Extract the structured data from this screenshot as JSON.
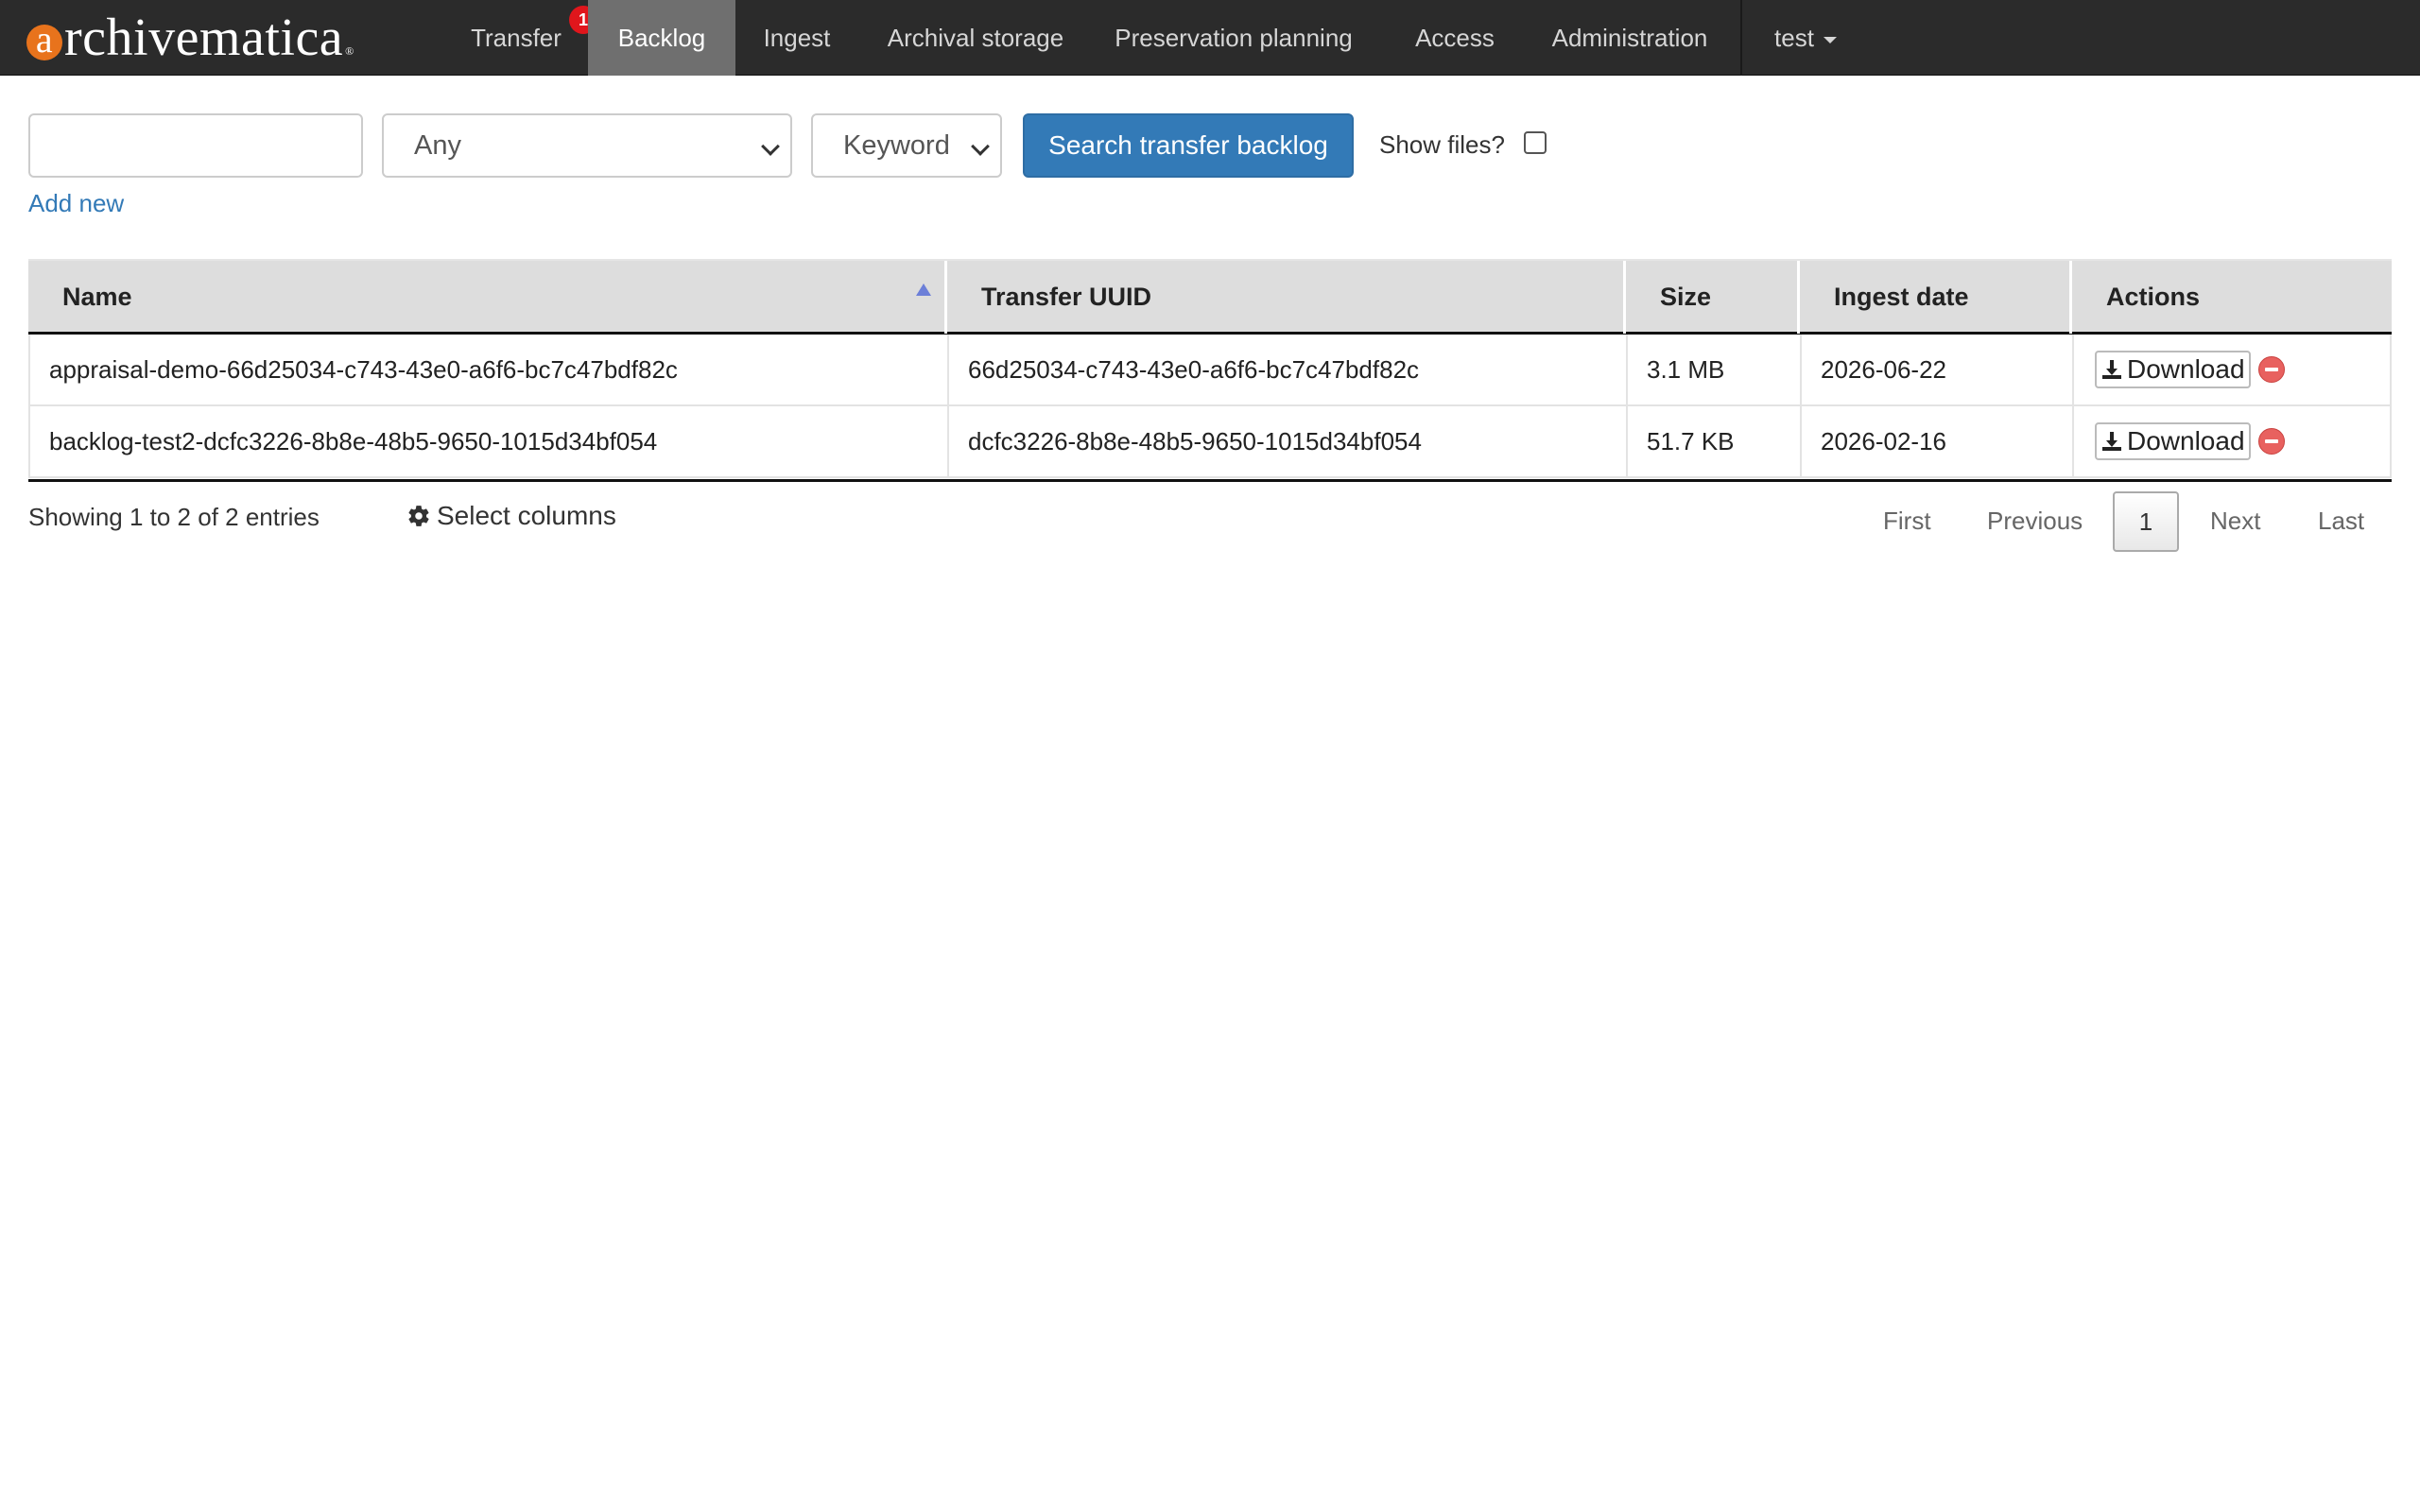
{
  "brand": {
    "initial": "a",
    "rest": "rchivematica",
    "reg": "®"
  },
  "nav": {
    "items": [
      {
        "label": "Transfer",
        "badge": "1"
      },
      {
        "label": "Backlog"
      },
      {
        "label": "Ingest"
      },
      {
        "label": "Archival storage"
      },
      {
        "label": "Preservation planning"
      },
      {
        "label": "Access"
      },
      {
        "label": "Administration"
      }
    ],
    "user": "test"
  },
  "search": {
    "query": "",
    "field_select": "Any",
    "type_select": "Keyword",
    "button": "Search transfer backlog",
    "show_files_label": "Show files?",
    "show_files_checked": false,
    "add_new": "Add new"
  },
  "table": {
    "columns": [
      "Name",
      "Transfer UUID",
      "Size",
      "Ingest date",
      "Actions"
    ],
    "rows": [
      {
        "name": "appraisal-demo-66d25034-c743-43e0-a6f6-bc7c47bdf82c",
        "uuid": "66d25034-c743-43e0-a6f6-bc7c47bdf82c",
        "size": "3.1 MB",
        "date": "2026-06-22",
        "action": "Download"
      },
      {
        "name": "backlog-test2-dcfc3226-8b8e-48b5-9650-1015d34bf054",
        "uuid": "dcfc3226-8b8e-48b5-9650-1015d34bf054",
        "size": "51.7 KB",
        "date": "2026-02-16",
        "action": "Download"
      }
    ]
  },
  "footer": {
    "info": "Showing 1 to 2 of 2 entries",
    "select_columns": "Select columns",
    "pager": {
      "first": "First",
      "previous": "Previous",
      "current": "1",
      "next": "Next",
      "last": "Last"
    }
  },
  "colors": {
    "navbar": "#2b2b2b",
    "active_tab": "#6f6f6f",
    "primary": "#337ab7",
    "badge": "#e0161c",
    "brand_accent": "#e8731c"
  }
}
